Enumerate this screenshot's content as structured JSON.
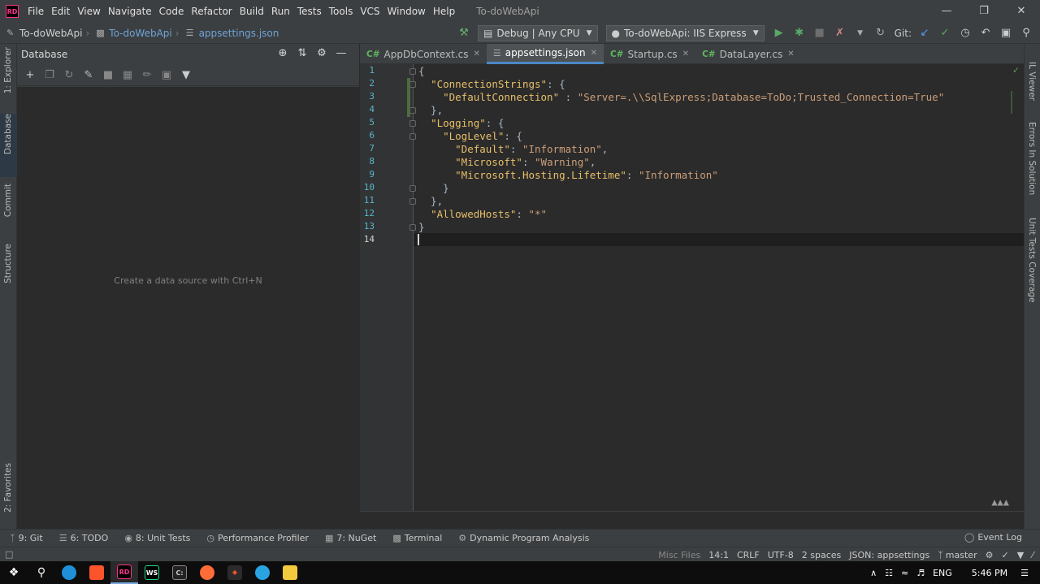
{
  "app": {
    "logo_text": "RD",
    "window_title": "To-doWebApi",
    "menu": [
      "File",
      "Edit",
      "View",
      "Navigate",
      "Code",
      "Refactor",
      "Build",
      "Run",
      "Tests",
      "Tools",
      "VCS",
      "Window",
      "Help"
    ]
  },
  "breadcrumb": {
    "solution": "To-doWebApi",
    "project": "To-doWebApi",
    "file": "appsettings.json"
  },
  "run": {
    "config": "Debug | Any CPU",
    "target": "To-doWebApi: IIS Express",
    "git_label": "Git:"
  },
  "left_stripe": {
    "explorer": "1: Explorer",
    "database": "Database",
    "commit": "Commit",
    "structure": "Structure",
    "favorites": "2: Favorites"
  },
  "db_panel": {
    "title": "Database",
    "empty_hint": "Create a data source with Ctrl+N"
  },
  "tabs": [
    {
      "lang": "C#",
      "label": "AppDbContext.cs"
    },
    {
      "lang": "{}",
      "label": "appsettings.json"
    },
    {
      "lang": "C#",
      "label": "Startup.cs"
    },
    {
      "lang": "C#",
      "label": "DataLayer.cs"
    }
  ],
  "editor": {
    "line_numbers": [
      "1",
      "2",
      "3",
      "4",
      "5",
      "6",
      "7",
      "8",
      "9",
      "10",
      "11",
      "12",
      "13",
      "14"
    ],
    "lines": [
      "{",
      "  \"ConnectionStrings\": {",
      "    \"DefaultConnection\" : \"Server=.\\\\SqlExpress;Database=ToDo;Trusted_Connection=True\"",
      "  },",
      "  \"Logging\": {",
      "    \"LogLevel\": {",
      "      \"Default\": \"Information\",",
      "      \"Microsoft\": \"Warning\",",
      "      \"Microsoft.Hosting.Lifetime\": \"Information\"",
      "    }",
      "  },",
      "  \"AllowedHosts\": \"*\"",
      "}",
      ""
    ]
  },
  "right_stripe": {
    "il_viewer": "IL Viewer",
    "errors": "Errors In Solution",
    "coverage": "Unit Tests Coverage"
  },
  "bottom_tools": [
    {
      "icon": "git-icon",
      "label": "9: Git"
    },
    {
      "icon": "todo-icon",
      "label": "6: TODO"
    },
    {
      "icon": "unit-tests-icon",
      "label": "8: Unit Tests"
    },
    {
      "icon": "profiler-icon",
      "label": "Performance Profiler"
    },
    {
      "icon": "nuget-icon",
      "label": "7: NuGet"
    },
    {
      "icon": "terminal-icon",
      "label": "Terminal"
    },
    {
      "icon": "dpa-icon",
      "label": "Dynamic Program Analysis"
    }
  ],
  "event_log": "Event Log",
  "status": {
    "misc": "Misc Files",
    "position": "14:1",
    "line_sep": "CRLF",
    "encoding": "UTF-8",
    "indent": "2 spaces",
    "schema": "JSON: appsettings",
    "branch": "master"
  },
  "taskbar": {
    "language": "ENG",
    "time": "5:46 PM"
  }
}
